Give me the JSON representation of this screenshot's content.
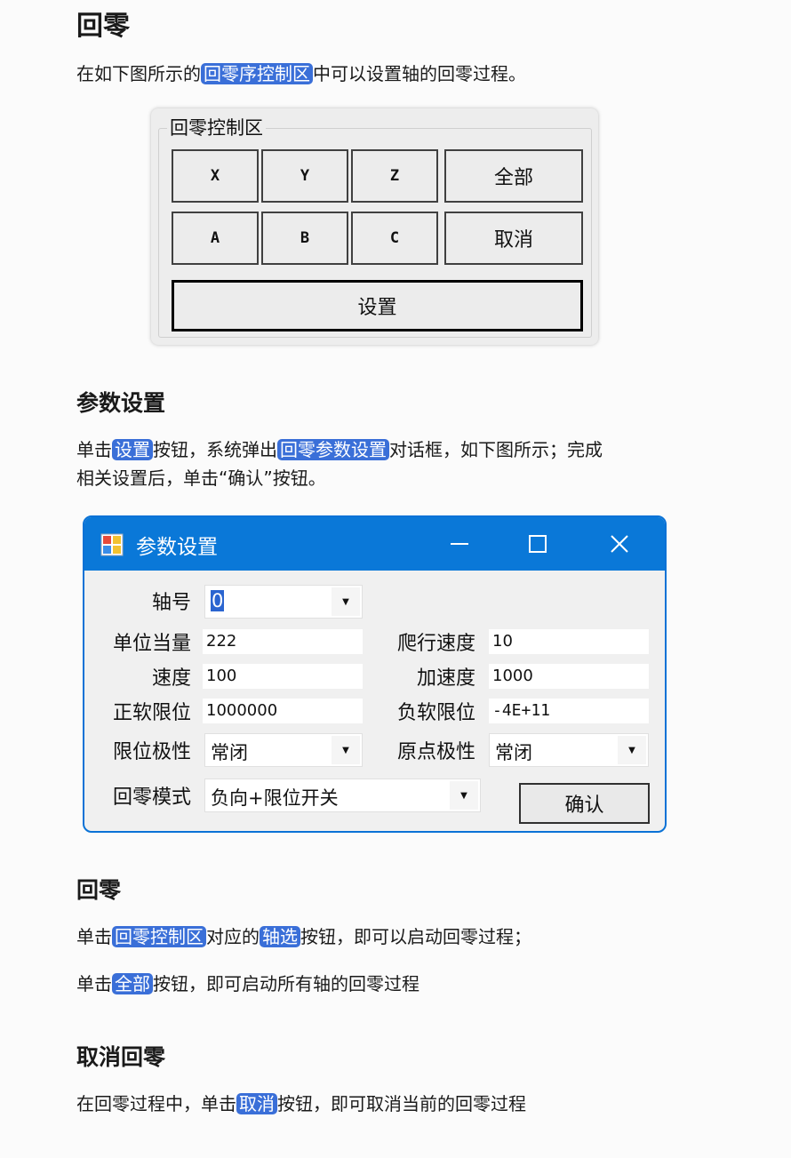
{
  "section1": {
    "heading": "回零",
    "p1": {
      "before": "在如下图所示的",
      "hl": "回零序控制区",
      "after": "中可以设置轴的回零过程。"
    }
  },
  "home_panel": {
    "group_title": "回零控制区",
    "buttons": [
      "X",
      "Y",
      "Z",
      "全部",
      "A",
      "B",
      "C",
      "取消"
    ],
    "setup_button": "设置"
  },
  "section2": {
    "heading": "参数设置",
    "p1": {
      "before": "单击",
      "hl1": "设置",
      "mid": "按钮，系统弹出",
      "hl2": "回零参数设置",
      "after": "对话框，如下图所示；完成"
    },
    "p2": "相关设置后，单击“确认”按钮。"
  },
  "dialog": {
    "title": "参数设置",
    "axis_label": "轴号",
    "axis_value": "0",
    "unit_label": "单位当量",
    "unit_value": "222",
    "crawl_label": "爬行速度",
    "crawl_value": "10",
    "speed_label": "速度",
    "speed_value": "100",
    "accel_label": "加速度",
    "accel_value": "1000",
    "pos_limit_label": "正软限位",
    "pos_limit_value": "1000000",
    "neg_limit_label": "负软限位",
    "neg_limit_value": "-4E+11",
    "limit_pol_label": "限位极性",
    "limit_pol_value": "常闭",
    "origin_pol_label": "原点极性",
    "origin_pol_value": "常闭",
    "mode_label": "回零模式",
    "mode_value": "负向+限位开关",
    "confirm": "确认",
    "accent": "#0a78d8"
  },
  "section3": {
    "heading": "回零",
    "p1": {
      "before": "单击",
      "hl1": "回零控制区",
      "mid": "对应的",
      "hl2": "轴选",
      "after": "按钮，即可以启动回零过程；"
    },
    "p2": {
      "before": "单击",
      "hl": "全部",
      "after": "按钮，即可启动所有轴的回零过程"
    }
  },
  "section4": {
    "heading": "取消回零",
    "p1": {
      "before": "在回零过程中，单击",
      "hl": "取消",
      "after": "按钮，即可取消当前的回零过程"
    }
  },
  "highlight_color": "#3a6fd8"
}
